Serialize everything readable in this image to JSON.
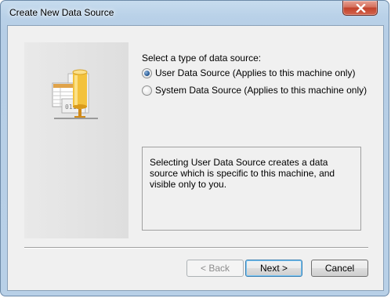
{
  "window": {
    "title": "Create New Data Source"
  },
  "titlebar": {
    "close_icon": "close-x-icon"
  },
  "wizard": {
    "illustration_icon": "data-source-database-icon",
    "prompt": "Select a type of data source:",
    "options": [
      {
        "label": "User Data Source (Applies to this machine only)",
        "checked": true
      },
      {
        "label": "System Data Source (Applies to this machine only)",
        "checked": false
      }
    ],
    "description": "Selecting User Data Source creates a data source which is specific to this machine, and visible only to you."
  },
  "buttons": {
    "back": "< Back",
    "next": "Next >",
    "cancel": "Cancel"
  }
}
